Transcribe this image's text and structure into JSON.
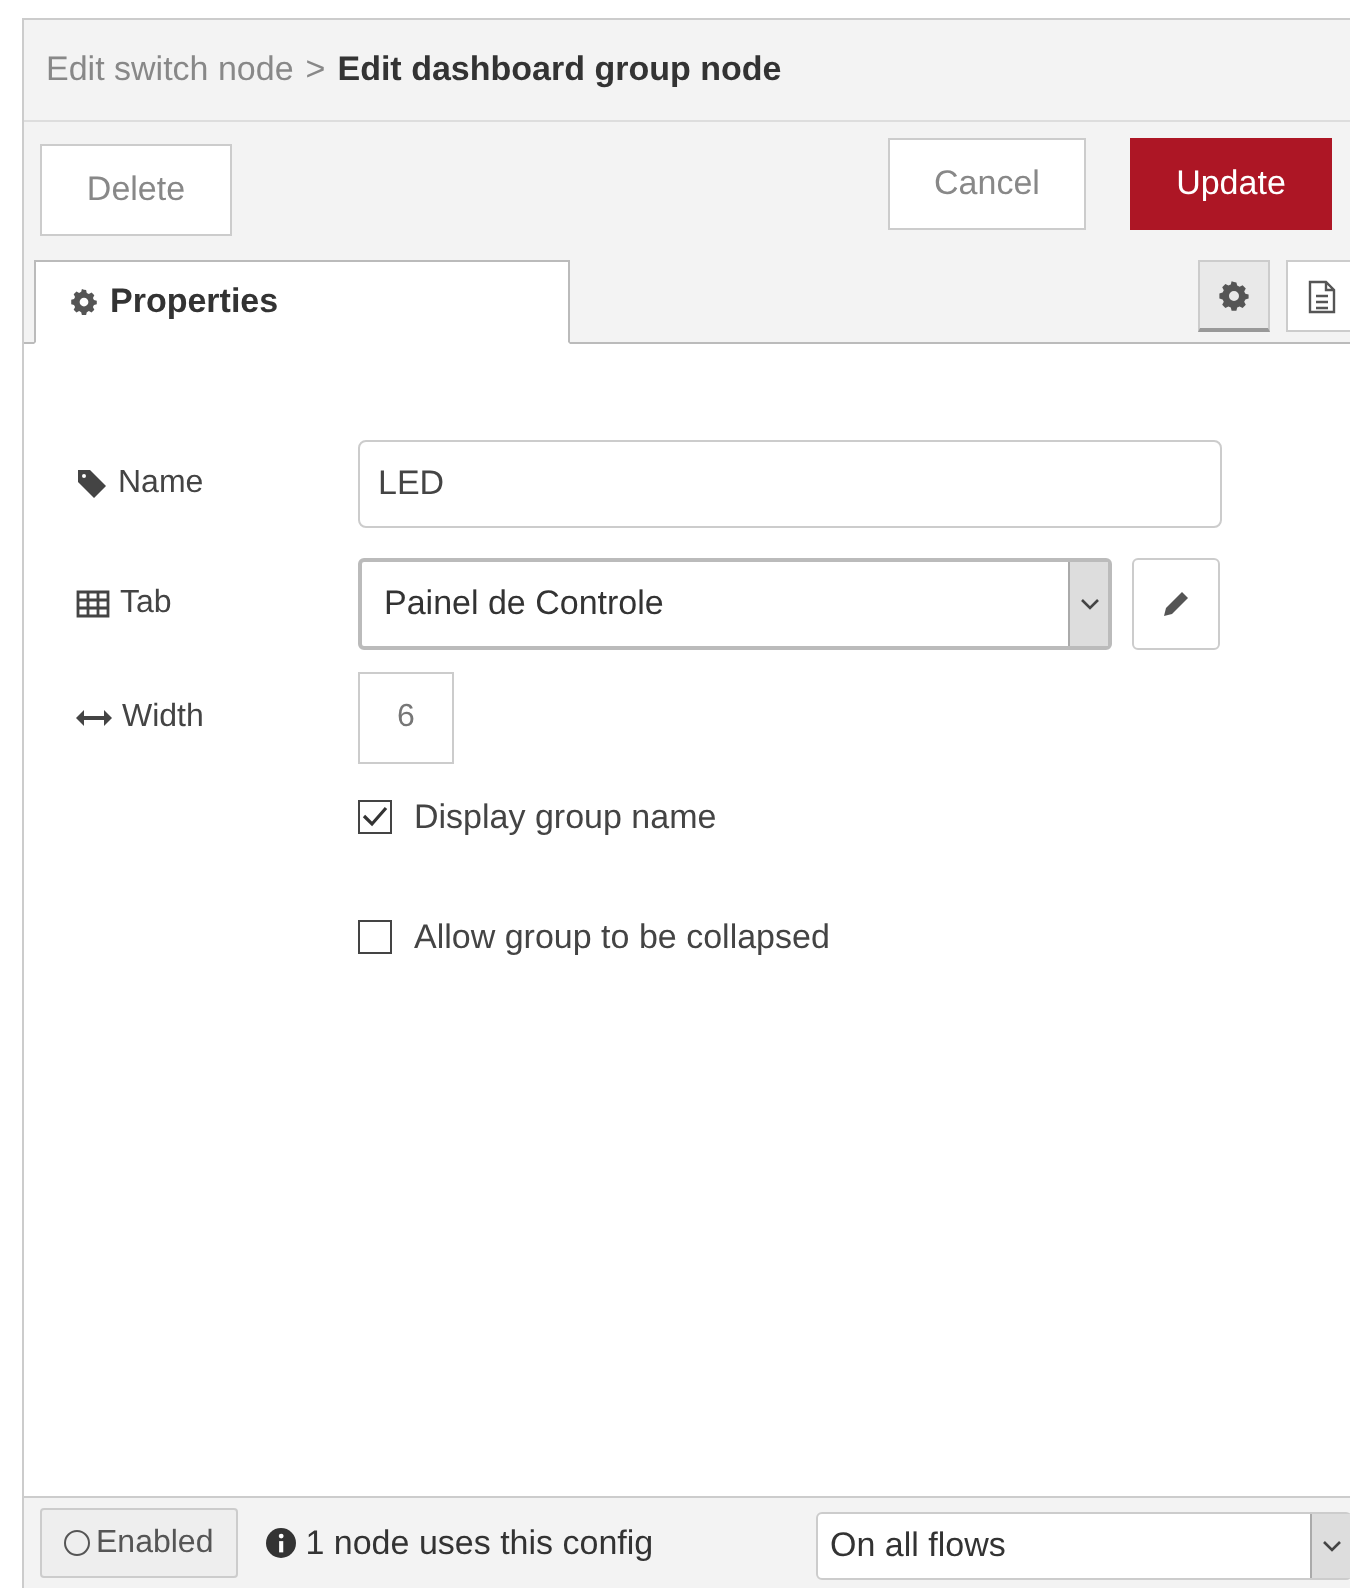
{
  "breadcrumb": {
    "parent": "Edit switch node",
    "separator": ">",
    "title": "Edit dashboard group node"
  },
  "buttons": {
    "delete": "Delete",
    "cancel": "Cancel",
    "update": "Update"
  },
  "tabs": [
    {
      "label": "Properties",
      "selected": true
    }
  ],
  "form": {
    "name": {
      "label": "Name",
      "value": "LED"
    },
    "tab": {
      "label": "Tab",
      "value": "Painel de Controle"
    },
    "width": {
      "label": "Width",
      "value": "6"
    },
    "checkboxes": [
      {
        "label": "Display group name",
        "checked": true
      },
      {
        "label": "Allow group to be collapsed",
        "checked": false
      }
    ]
  },
  "footer": {
    "enabled": {
      "label": "Enabled",
      "on": false
    },
    "usage": "1 node uses this config",
    "scope": "On all flows"
  }
}
